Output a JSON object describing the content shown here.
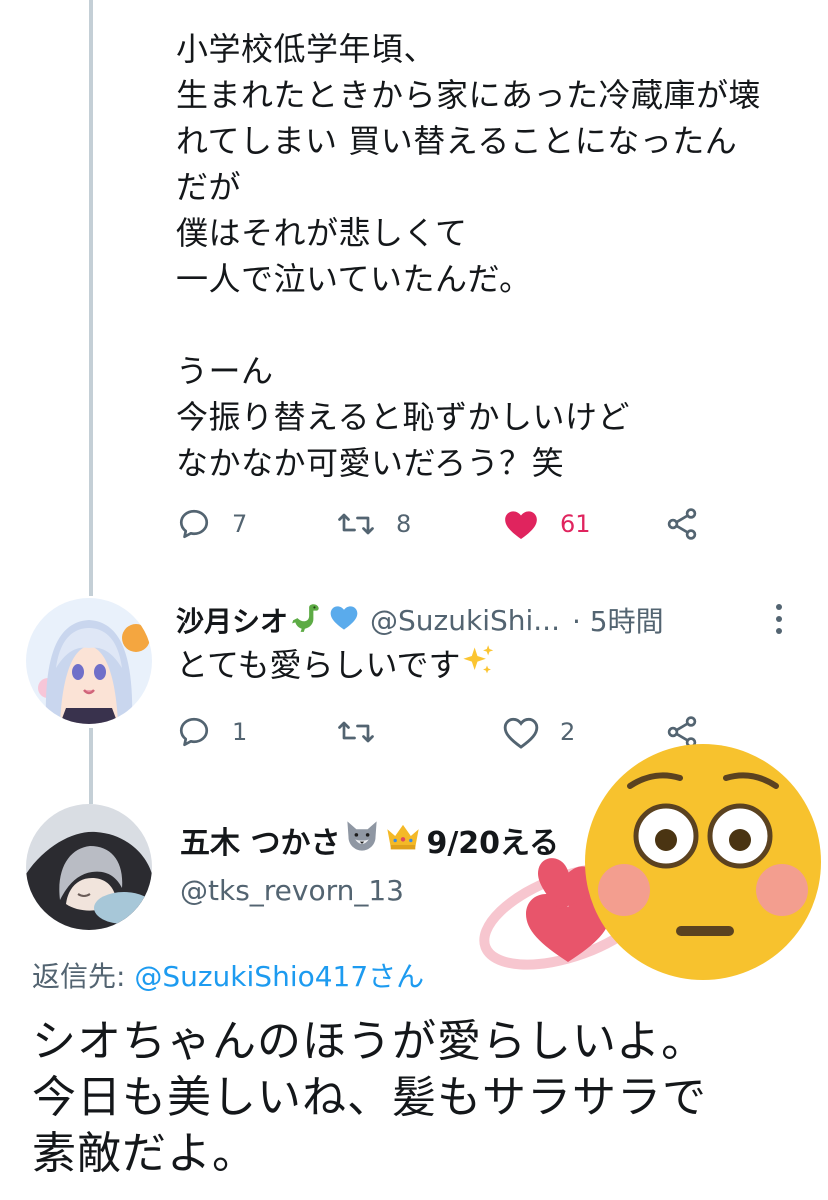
{
  "tweet": {
    "text": "小学校低学年頃、\n生まれたときから家にあった冷蔵庫が壊\nれてしまい 買い替えることになったん\nだが\n僕はそれが悲しくて\n一人で泣いていたんだ。\n\nうーん\n今振り替えると恥ずかしいけど\nなかなか可愛いだろう？笑",
    "reply_count": "7",
    "retweet_count": "8",
    "like_count": "61",
    "liked": true
  },
  "reply1": {
    "display_name": "沙月シオ",
    "handle": "@SuzukiShi...",
    "time": "· 5時間",
    "text": "とても愛らしいです",
    "reply_count": "1",
    "like_count": "2",
    "badges": [
      "dinosaur-emoji",
      "blue-heart-emoji"
    ],
    "trailing_emoji": "sparkles-emoji"
  },
  "reply2": {
    "display_name": "五木 つかさ",
    "name_suffix": "9/20える",
    "handle": "@tks_revorn_13",
    "badges": [
      "wolf-emoji",
      "crown-emoji"
    ],
    "reply_to_label": "返信先: ",
    "reply_to_mention": "@SuzukiShio417さん",
    "text": "シオちゃんのほうが愛らしいよ。\n今日も美しいね、髪もサラサラで\n素敵だよ。"
  },
  "overlay": {
    "sticker": "flushed-face-with-hearts",
    "colors": {
      "face": "#f7c22e",
      "blush": "#f29a9a",
      "heart": "#e8556b"
    }
  },
  "colors": {
    "muted": "#536471",
    "accent": "#1d9bf0",
    "like": "#e0245e",
    "thread": "#c4cfd6"
  }
}
